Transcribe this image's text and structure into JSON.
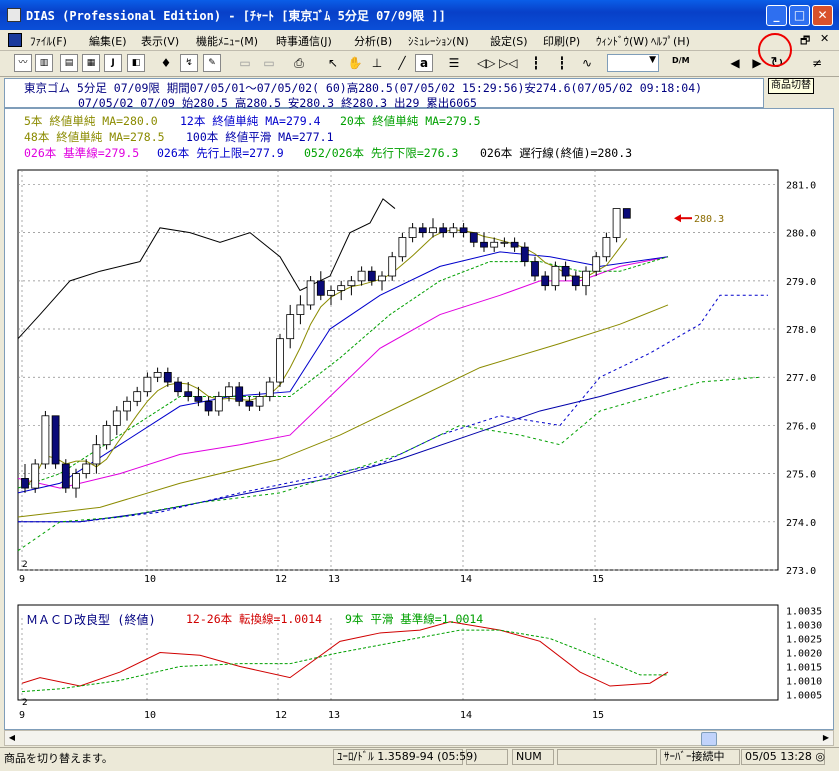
{
  "window": {
    "title": "DIAS (Professional Edition) - [ﾁｬｰﾄ [東京ｺﾞﾑ       5分足 07/09限 ]]"
  },
  "menu": [
    "ﾌｧｲﾙ(F)",
    "編集(E)",
    "表示(V)",
    "機能ﾒﾆｭｰ(M)",
    "時事通信(J)",
    "分析(B)",
    "ｼﾐｭﾚｰｼｮﾝ(N)",
    "設定(S)",
    "印刷(P)",
    "ｳｨﾝﾄﾞｳ(W)",
    "ﾍﾙﾌﾟ(H)"
  ],
  "toolbar": {
    "tooltip": "商品切替",
    "text_tool": "a",
    "dm_label": "D/M"
  },
  "info": {
    "line1": "東京ゴム    5分足 07/09限 期間07/05/01～07/05/02( 60)高280.5(07/05/02 15:29:56)安274.6(07/05/02 09:18:04)",
    "line2": "07/05/02 07/09 始280.5 高280.5 安280.3 終280.3 出29 累出6065"
  },
  "legend": {
    "ma5": "5本 終値単純 MA=280.0",
    "ma12": "12本 終値単純 MA=279.4",
    "ma20": "20本 終値単純 MA=279.5",
    "ma48": "48本 終値単純 MA=278.5",
    "ma100": "100本 終値平滑 MA=277.1",
    "kijun": "026本 基準線=279.5",
    "senko_a": "026本 先行上限=277.9",
    "senko_b": "052/026本 先行下限=276.3",
    "chikou": "026本 遅行線(終値)=280.3"
  },
  "price_label": "280.3",
  "price_axis": [
    "281.0",
    "280.0",
    "279.0",
    "278.0",
    "277.0",
    "276.0",
    "275.0",
    "274.0",
    "273.0"
  ],
  "x_axis": [
    {
      "label": "9",
      "day": 9
    },
    {
      "label": "10",
      "day": 10
    },
    {
      "label": "12",
      "day": 12
    },
    {
      "label": "13",
      "day": 13
    },
    {
      "label": "14",
      "day": 14
    },
    {
      "label": "15",
      "day": 15
    }
  ],
  "corner_label": "2",
  "macd": {
    "title": "ＭＡＣＤ改良型 (終値)",
    "line": "12-26本 転換線=1.0014",
    "signal": "9本 平滑 基準線=1.0014",
    "axis": [
      "1.0035",
      "1.0030",
      "1.0025",
      "1.0020",
      "1.0015",
      "1.0010",
      "1.0005"
    ]
  },
  "colors": {
    "ma5": "#8b8b00",
    "ma12": "#0000cc",
    "ma20": "#00a000",
    "ma48": "#8b8b00",
    "ma100": "#0000aa",
    "kijun": "#e000e0",
    "senko_a": "#0000cc",
    "senko_b": "#00a000",
    "chikou": "#000000",
    "macd_line": "#d00000",
    "macd_signal": "#00a000",
    "candle_down": "#0a0a78",
    "arrow": "#e00000"
  },
  "chart_data": {
    "type": "candlestick",
    "ylim": [
      273.0,
      281.3
    ],
    "candles": [
      [
        274.9,
        275.2,
        274.6,
        274.7
      ],
      [
        274.7,
        275.3,
        274.6,
        275.2
      ],
      [
        275.2,
        276.3,
        275.1,
        276.2
      ],
      [
        276.2,
        276.2,
        275.1,
        275.2
      ],
      [
        275.2,
        275.3,
        274.6,
        274.7
      ],
      [
        274.7,
        275.1,
        274.5,
        275.0
      ],
      [
        275.0,
        275.3,
        274.9,
        275.2
      ],
      [
        275.2,
        275.8,
        275.0,
        275.6
      ],
      [
        275.6,
        276.1,
        275.5,
        276.0
      ],
      [
        276.0,
        276.4,
        275.8,
        276.3
      ],
      [
        276.3,
        276.6,
        276.1,
        276.5
      ],
      [
        276.5,
        276.8,
        276.4,
        276.7
      ],
      [
        276.7,
        277.1,
        276.6,
        277.0
      ],
      [
        277.0,
        277.2,
        276.9,
        277.1
      ],
      [
        277.1,
        277.2,
        276.8,
        276.9
      ],
      [
        276.9,
        277.0,
        276.6,
        276.7
      ],
      [
        276.7,
        276.9,
        276.5,
        276.6
      ],
      [
        276.6,
        276.8,
        276.4,
        276.5
      ],
      [
        276.5,
        276.6,
        276.2,
        276.3
      ],
      [
        276.3,
        276.7,
        276.2,
        276.6
      ],
      [
        276.6,
        276.9,
        276.5,
        276.8
      ],
      [
        276.8,
        276.9,
        276.4,
        276.5
      ],
      [
        276.5,
        276.6,
        276.3,
        276.4
      ],
      [
        276.4,
        276.7,
        276.3,
        276.6
      ],
      [
        276.6,
        277.0,
        276.5,
        276.9
      ],
      [
        276.9,
        277.9,
        276.8,
        277.8
      ],
      [
        277.8,
        278.5,
        277.6,
        278.3
      ],
      [
        278.3,
        278.7,
        278.1,
        278.5
      ],
      [
        278.5,
        279.1,
        278.4,
        279.0
      ],
      [
        279.0,
        279.2,
        278.6,
        278.7
      ],
      [
        278.7,
        278.9,
        278.5,
        278.8
      ],
      [
        278.8,
        279.0,
        278.6,
        278.9
      ],
      [
        278.9,
        279.1,
        278.7,
        279.0
      ],
      [
        279.0,
        279.3,
        278.9,
        279.2
      ],
      [
        279.2,
        279.3,
        278.9,
        279.0
      ],
      [
        279.0,
        279.2,
        278.8,
        279.1
      ],
      [
        279.1,
        279.6,
        279.0,
        279.5
      ],
      [
        279.5,
        280.0,
        279.4,
        279.9
      ],
      [
        279.9,
        280.2,
        279.8,
        280.1
      ],
      [
        280.1,
        280.2,
        279.9,
        280.0
      ],
      [
        280.0,
        280.3,
        279.9,
        280.1
      ],
      [
        280.1,
        280.2,
        279.9,
        280.0
      ],
      [
        280.0,
        280.2,
        279.9,
        280.1
      ],
      [
        280.1,
        280.2,
        279.9,
        280.0
      ],
      [
        280.0,
        280.0,
        279.7,
        279.8
      ],
      [
        279.8,
        280.0,
        279.6,
        279.7
      ],
      [
        279.7,
        279.9,
        279.6,
        279.8
      ],
      [
        279.8,
        279.9,
        279.7,
        279.8
      ],
      [
        279.8,
        279.9,
        279.6,
        279.7
      ],
      [
        279.7,
        279.8,
        279.3,
        279.4
      ],
      [
        279.4,
        279.5,
        279.0,
        279.1
      ],
      [
        279.1,
        279.2,
        278.8,
        278.9
      ],
      [
        278.9,
        279.4,
        278.8,
        279.3
      ],
      [
        279.3,
        279.4,
        279.0,
        279.1
      ],
      [
        279.1,
        279.2,
        278.8,
        278.9
      ],
      [
        278.9,
        279.3,
        278.7,
        279.2
      ],
      [
        279.2,
        279.6,
        279.1,
        279.5
      ],
      [
        279.5,
        280.0,
        279.4,
        279.9
      ],
      [
        279.9,
        280.5,
        279.8,
        280.5
      ],
      [
        280.5,
        280.5,
        280.3,
        280.3
      ]
    ],
    "macd_ylim": [
      1.0003,
      1.0037
    ]
  }
}
